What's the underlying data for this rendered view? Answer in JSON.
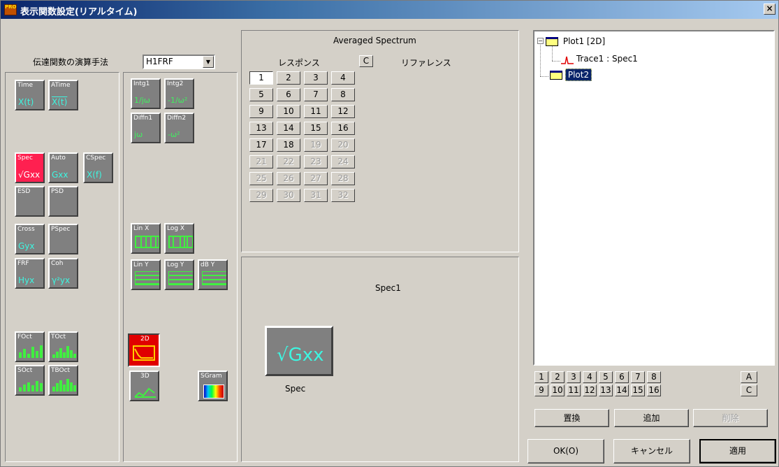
{
  "window": {
    "title": "表示関数設定(リアルタイム)",
    "icon": "app-icon",
    "close": "×"
  },
  "left": {
    "method_label": "伝達関数の演算手法",
    "method_value": "H1FRF",
    "col1": [
      {
        "id": "time",
        "title": "Time",
        "glyph": "X(t)"
      },
      {
        "id": "atime",
        "title": "ATime",
        "glyph": "X(t)"
      },
      {
        "id": "spec",
        "title": "Spec",
        "glyph": "√Gxx",
        "selected": true
      },
      {
        "id": "auto",
        "title": "Auto",
        "glyph": "Gxx"
      },
      {
        "id": "cspec",
        "title": "CSpec",
        "glyph": "X(f)"
      },
      {
        "id": "esd",
        "title": "ESD",
        "glyph": ""
      },
      {
        "id": "psd",
        "title": "PSD",
        "glyph": ""
      },
      {
        "id": "cross",
        "title": "Cross",
        "glyph": "Gyx"
      },
      {
        "id": "pspec",
        "title": "PSpec",
        "glyph": ""
      },
      {
        "id": "frf",
        "title": "FRF",
        "glyph": "Hyx"
      },
      {
        "id": "coh",
        "title": "Coh",
        "glyph": "γ²yx"
      },
      {
        "id": "foct",
        "title": "FOct",
        "glyph": ""
      },
      {
        "id": "toct",
        "title": "TOct",
        "glyph": ""
      },
      {
        "id": "soct",
        "title": "SOct",
        "glyph": ""
      },
      {
        "id": "tboct",
        "title": "TBOct",
        "glyph": ""
      }
    ],
    "col2": [
      {
        "id": "intg1",
        "title": "Intg1",
        "glyph": "1/jω"
      },
      {
        "id": "intg2",
        "title": "Intg2",
        "glyph": "-1/ω²"
      },
      {
        "id": "diffn1",
        "title": "Diffn1",
        "glyph": "jω"
      },
      {
        "id": "diffn2",
        "title": "Diffn2",
        "glyph": "-ω²"
      },
      {
        "id": "linx",
        "title": "Lin X",
        "glyph": ""
      },
      {
        "id": "logx",
        "title": "Log X",
        "glyph": ""
      },
      {
        "id": "liny",
        "title": "Lin Y",
        "glyph": ""
      },
      {
        "id": "logy",
        "title": "Log Y",
        "glyph": ""
      },
      {
        "id": "dby",
        "title": "dB Y",
        "glyph": ""
      },
      {
        "id": "2d",
        "title": "2D",
        "glyph": "",
        "selected": true
      },
      {
        "id": "3d",
        "title": "3D",
        "glyph": ""
      },
      {
        "id": "sgram",
        "title": "SGram",
        "glyph": ""
      }
    ]
  },
  "spectrum": {
    "title": "Averaged Spectrum",
    "response_label": "レスポンス",
    "c_button": "C",
    "reference_label": "リファレンス",
    "channels": [
      "1",
      "2",
      "3",
      "4",
      "5",
      "6",
      "7",
      "8",
      "9",
      "10",
      "11",
      "12",
      "13",
      "14",
      "15",
      "16",
      "17",
      "18",
      "19",
      "20",
      "21",
      "22",
      "23",
      "24",
      "25",
      "26",
      "27",
      "28",
      "29",
      "30",
      "31",
      "32"
    ],
    "enabled_count": 18,
    "selected": "1"
  },
  "preview": {
    "name": "Spec1",
    "icon_glyph": "√Gxx",
    "icon_label": "Spec"
  },
  "tree": {
    "plot1": "Plot1 [2D]",
    "trace1": "Trace1 : Spec1",
    "plot2": "Plot2"
  },
  "plot_numbers": [
    "1",
    "2",
    "3",
    "4",
    "5",
    "6",
    "7",
    "8",
    "9",
    "10",
    "11",
    "12",
    "13",
    "14",
    "15",
    "16"
  ],
  "side_a": "A",
  "side_c": "C",
  "actions": {
    "replace": "置換",
    "add": "追加",
    "delete": "削除"
  },
  "footer": {
    "ok": "OK(O)",
    "cancel": "キャンセル",
    "apply": "適用"
  }
}
